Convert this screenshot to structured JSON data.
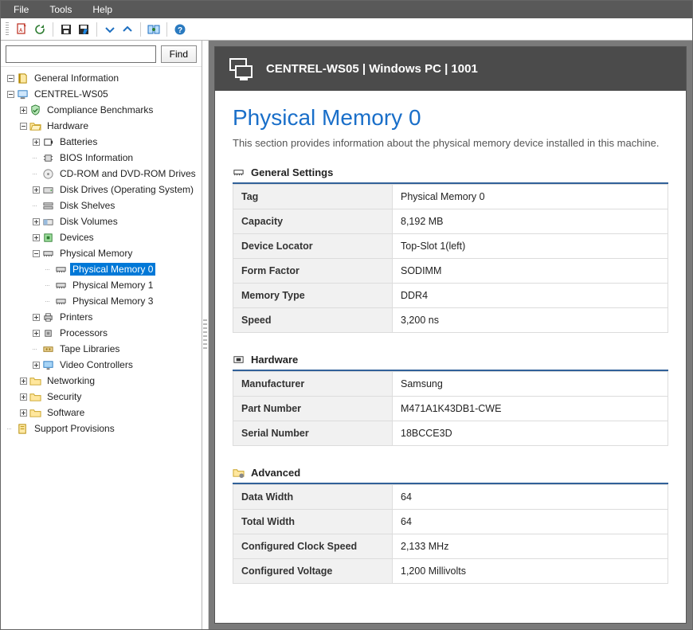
{
  "menubar": {
    "file": "File",
    "tools": "Tools",
    "help": "Help"
  },
  "search": {
    "value": "",
    "find_label": "Find"
  },
  "header": {
    "title": "CENTREL-WS05 | Windows PC | 1001"
  },
  "page": {
    "title": "Physical Memory 0",
    "description": "This section provides information about the physical memory device installed in this machine."
  },
  "sections": {
    "general": {
      "title": "General Settings",
      "rows": [
        {
          "k": "Tag",
          "v": "Physical Memory 0"
        },
        {
          "k": "Capacity",
          "v": "8,192 MB"
        },
        {
          "k": "Device Locator",
          "v": "Top-Slot 1(left)"
        },
        {
          "k": "Form Factor",
          "v": "SODIMM"
        },
        {
          "k": "Memory Type",
          "v": "DDR4"
        },
        {
          "k": "Speed",
          "v": "3,200 ns"
        }
      ]
    },
    "hardware": {
      "title": "Hardware",
      "rows": [
        {
          "k": "Manufacturer",
          "v": "Samsung"
        },
        {
          "k": "Part Number",
          "v": "M471A1K43DB1-CWE"
        },
        {
          "k": "Serial Number",
          "v": "18BCCE3D"
        }
      ]
    },
    "advanced": {
      "title": "Advanced",
      "rows": [
        {
          "k": "Data Width",
          "v": "64"
        },
        {
          "k": "Total Width",
          "v": "64"
        },
        {
          "k": "Configured Clock Speed",
          "v": "2,133 MHz"
        },
        {
          "k": "Configured Voltage",
          "v": "1,200 Millivolts"
        }
      ]
    }
  },
  "tree": {
    "root": "General Information",
    "host": "CENTREL-WS05",
    "nodes": {
      "compliance": "Compliance Benchmarks",
      "hardware": "Hardware",
      "batteries": "Batteries",
      "bios": "BIOS Information",
      "cdrom": "CD-ROM and DVD-ROM Drives",
      "diskdrives": "Disk Drives (Operating System)",
      "diskshelves": "Disk Shelves",
      "diskvolumes": "Disk Volumes",
      "devices": "Devices",
      "physmem": "Physical Memory",
      "pm0": "Physical Memory 0",
      "pm1": "Physical Memory 1",
      "pm3": "Physical Memory 3",
      "printers": "Printers",
      "processors": "Processors",
      "tapelib": "Tape Libraries",
      "video": "Video Controllers",
      "networking": "Networking",
      "security": "Security",
      "software": "Software",
      "support": "Support Provisions"
    }
  }
}
